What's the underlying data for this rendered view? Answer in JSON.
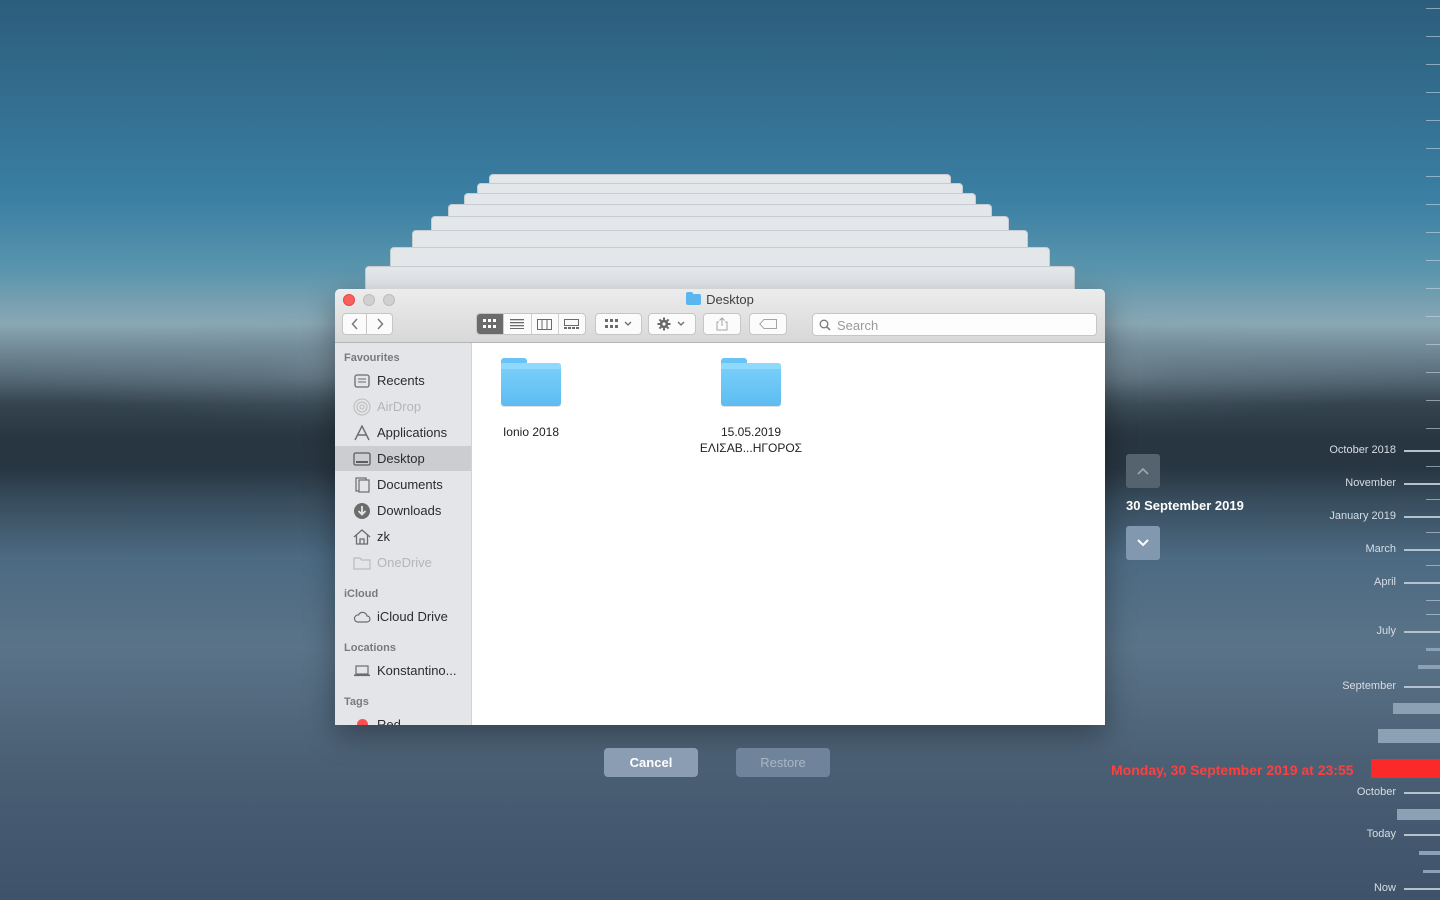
{
  "window": {
    "title": "Desktop",
    "search_placeholder": "Search"
  },
  "sidebar": {
    "favourites_header": "Favourites",
    "favourites": [
      {
        "label": "Recents",
        "icon": "recents-icon"
      },
      {
        "label": "AirDrop",
        "icon": "airdrop-icon"
      },
      {
        "label": "Applications",
        "icon": "applications-icon"
      },
      {
        "label": "Desktop",
        "icon": "desktop-icon"
      },
      {
        "label": "Documents",
        "icon": "documents-icon"
      },
      {
        "label": "Downloads",
        "icon": "downloads-icon"
      },
      {
        "label": "zk",
        "icon": "home-icon"
      },
      {
        "label": "OneDrive",
        "icon": "folder-icon"
      }
    ],
    "icloud_header": "iCloud",
    "icloud": [
      {
        "label": "iCloud Drive",
        "icon": "cloud-icon"
      }
    ],
    "locations_header": "Locations",
    "locations": [
      {
        "label": "Konstantino...",
        "icon": "laptop-icon"
      }
    ],
    "tags_header": "Tags",
    "tags": [
      {
        "label": "Red",
        "color": "#fc4f4f"
      }
    ]
  },
  "files": [
    {
      "name_line1": "Ionio 2018",
      "name_line2": ""
    },
    {
      "name_line1": "15.05.2019",
      "name_line2": "ΕΛΙΣΑΒ...ΗΓΟΡΟΣ"
    }
  ],
  "buttons": {
    "cancel": "Cancel",
    "restore": "Restore"
  },
  "time_machine": {
    "current_date": "30 September 2019",
    "restore_point": "Monday, 30 September 2019 at 23:55",
    "timeline_labels": [
      "October 2018",
      "November",
      "January 2019",
      "March",
      "April",
      "July",
      "September",
      "October",
      "Today",
      "Now"
    ],
    "accent_color": "#fb2a2a"
  }
}
